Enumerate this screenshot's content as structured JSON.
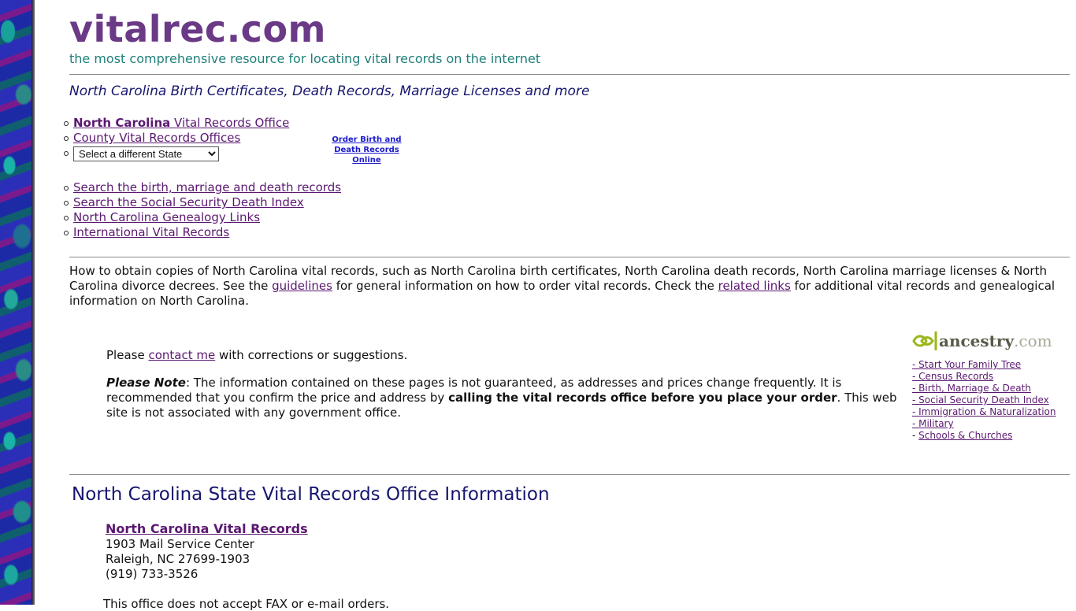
{
  "header": {
    "site_title": "vitalrec.com",
    "tagline": "the most comprehensive resource for locating vital records on the internet",
    "subtitle": "North Carolina Birth Certificates, Death Records, Marriage Licenses and more"
  },
  "nav_primary": {
    "state_office_bold": "North Carolina",
    "state_office_rest": " Vital Records Office",
    "county_offices": "County Vital Records Offices",
    "state_select": {
      "selected": "Select a different State",
      "options": [
        "Select a different State"
      ]
    }
  },
  "order_online": {
    "line1": "Order Birth and",
    "line2": "Death Records Online"
  },
  "nav_secondary": [
    {
      "label": "Search the birth, marriage and death records"
    },
    {
      "label": "Search the Social Security Death Index"
    },
    {
      "label": "North Carolina Genealogy Links"
    },
    {
      "label": "International Vital Records"
    }
  ],
  "intro": {
    "text1": "How to obtain copies of North Carolina vital records, such as North Carolina birth certificates, North Carolina death records, North Carolina marriage licenses & North Carolina divorce decrees. See the ",
    "guidelines_link": "guidelines",
    "text2": " for general information on how to order vital records. Check the ",
    "related_link": "related links",
    "text3": " for additional vital records and genealogical information on North Carolina."
  },
  "contact": {
    "pre": "Please ",
    "link": "contact me",
    "post": " with corrections or suggestions."
  },
  "note": {
    "label": "Please Note",
    "text1": ": The information contained on these pages is not guaranteed, as addresses and prices change frequently. It is recommended that you confirm the price and address by ",
    "bold": "calling the vital records office before you place your order",
    "text2": ". This web site is not associated with any government office."
  },
  "ancestry": {
    "logo_word": "ancestry",
    "logo_suffix": ".com",
    "links": [
      {
        "label": "- Start Your Family Tree"
      },
      {
        "label": "- Census Records"
      },
      {
        "label": "- Birth, Marriage & Death"
      },
      {
        "label": "- Social Security Death Index"
      },
      {
        "label": "- Immigration & Naturalization"
      },
      {
        "label": "- Military"
      },
      {
        "label": "Schools & Churches",
        "prefix": "- "
      }
    ]
  },
  "office_section": {
    "title": "North Carolina State Vital Records Office Information",
    "name": "North Carolina Vital Records",
    "address1": "1903 Mail Service Center",
    "address2": "Raleigh, NC 27699-1903",
    "phone": "(919) 733-3526",
    "fax_note": "This office does not accept FAX or e-mail orders."
  },
  "colors": {
    "brand_purple": "#6b3a86",
    "tagline_teal": "#1f7f7a",
    "heading_navy": "#16166e",
    "link_visited": "#5a1870",
    "link_blue": "#1a1acc"
  }
}
